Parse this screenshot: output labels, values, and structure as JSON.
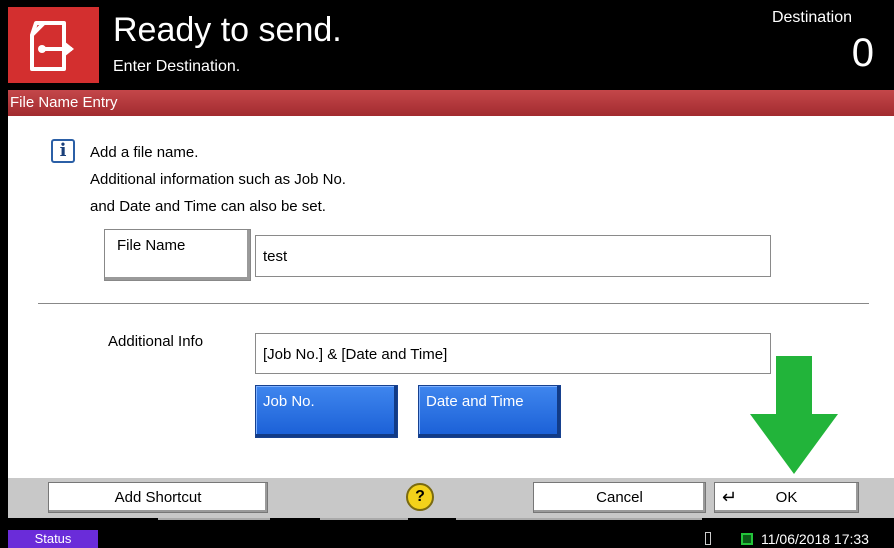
{
  "header": {
    "title": "Ready to send.",
    "subtitle": "Enter Destination.",
    "destination_label": "Destination",
    "destination_count": "0",
    "icon": "send-document-icon"
  },
  "dialog": {
    "title": "File Name Entry",
    "info_icon": "info-icon",
    "info_lines": [
      "Add a file name.",
      "Additional information such as Job No.",
      "and Date and Time can also be set."
    ],
    "file_name_button": "File Name",
    "file_name_value": "test",
    "additional_info_label": "Additional Info",
    "additional_info_value": "[Job No.] & [Date and Time]",
    "job_no_button": "Job No.",
    "date_time_button": "Date and Time"
  },
  "bottom_bar": {
    "add_shortcut": "Add Shortcut",
    "help": "?",
    "cancel": "Cancel",
    "ok": "OK"
  },
  "status_bar": {
    "status_button": "Status",
    "datetime": "11/06/2018  17:33"
  },
  "colors": {
    "header_icon_bg": "#d32f2f",
    "title_bar": "#b3353a",
    "blue_button": "#2a6fe3",
    "status_button": "#6a2cd9",
    "help_button": "#f3d21b",
    "arrow": "#22b43a"
  }
}
